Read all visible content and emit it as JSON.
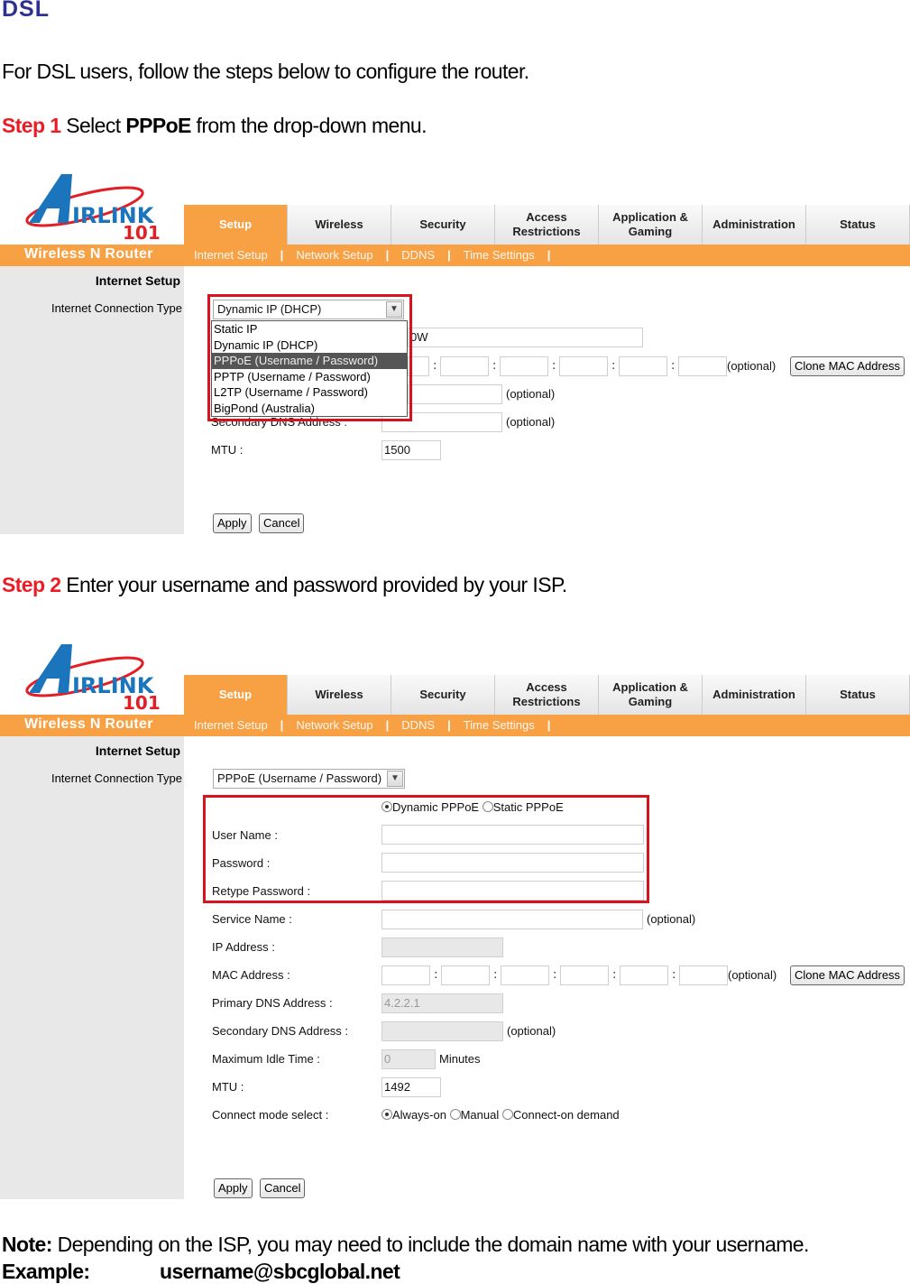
{
  "doc": {
    "title": "DSL",
    "intro": "For DSL users, follow the steps below to configure the router.",
    "step1": {
      "label": "Step 1",
      "text_before": " Select ",
      "bold": "PPPoE",
      "text_after": " from the drop-down menu."
    },
    "step2": {
      "label": "Step 2",
      "text": " Enter your username and password provided by your ISP."
    },
    "note": {
      "label": "Note:",
      "text": " Depending on the ISP, you may need to include the domain name with your username."
    },
    "example": {
      "label": "Example:",
      "value": "username@sbcglobal.net"
    }
  },
  "router": {
    "logo": {
      "brand": "IRLINK",
      "number": "101",
      "registered": "®",
      "letter": "A"
    },
    "brand_bar": "Wireless N Router",
    "tabs": [
      "Setup",
      "Wireless",
      "Security",
      "Access Restrictions",
      "Application & Gaming",
      "Administration",
      "Status"
    ],
    "active_tab": "Setup",
    "subnav": [
      "Internet Setup",
      "Network Setup",
      "DDNS",
      "Time Settings"
    ],
    "section_title": "Internet Setup",
    "connection_type_label": "Internet Connection Type",
    "colors": {
      "orange": "#f7a044",
      "highlight_box": "#d7141e",
      "step_red": "#ed1c24",
      "title_blue": "#2e3192"
    }
  },
  "screen1": {
    "select_value": "Dynamic IP (DHCP)",
    "options": [
      "Static IP",
      "Dynamic IP (DHCP)",
      "PPPoE (Username / Password)",
      "PPTP (Username / Password)",
      "L2TP (Username / Password)",
      "BigPond (Australia)"
    ],
    "highlighted_option": "PPPoE (Username / Password)",
    "hostname_partial": "0W",
    "optional": "(optional)",
    "clone_mac": "Clone MAC Address",
    "secondary_dns_label": "Secondary DNS Address :",
    "mtu_label": "MTU :",
    "mtu_value": "1500",
    "apply": "Apply",
    "cancel": "Cancel"
  },
  "screen2": {
    "select_value": "PPPoE (Username / Password)",
    "pppoe_mode": [
      {
        "label": "Dynamic PPPoE",
        "checked": true
      },
      {
        "label": "Static PPPoE",
        "checked": false
      }
    ],
    "fields": {
      "user_name": {
        "label": "User Name :",
        "value": ""
      },
      "password": {
        "label": "Password :",
        "value": ""
      },
      "retype_password": {
        "label": "Retype Password :",
        "value": ""
      },
      "service_name": {
        "label": "Service Name :",
        "value": "",
        "note": "(optional)"
      },
      "ip_address": {
        "label": "IP Address :",
        "value": ""
      },
      "mac_address": {
        "label": "MAC Address :",
        "note": "(optional)"
      },
      "primary_dns": {
        "label": "Primary DNS Address :",
        "value": "4.2.2.1"
      },
      "secondary_dns": {
        "label": "Secondary DNS Address :",
        "value": "",
        "note": "(optional)"
      },
      "max_idle": {
        "label": "Maximum Idle Time :",
        "value": "0",
        "unit": "Minutes"
      },
      "mtu": {
        "label": "MTU :",
        "value": "1492"
      },
      "connect_mode": {
        "label": "Connect mode select :"
      }
    },
    "connect_modes": [
      {
        "label": "Always-on",
        "checked": true
      },
      {
        "label": "Manual",
        "checked": false
      },
      {
        "label": "Connect-on demand",
        "checked": false
      }
    ],
    "clone_mac": "Clone MAC Address",
    "apply": "Apply",
    "cancel": "Cancel"
  }
}
